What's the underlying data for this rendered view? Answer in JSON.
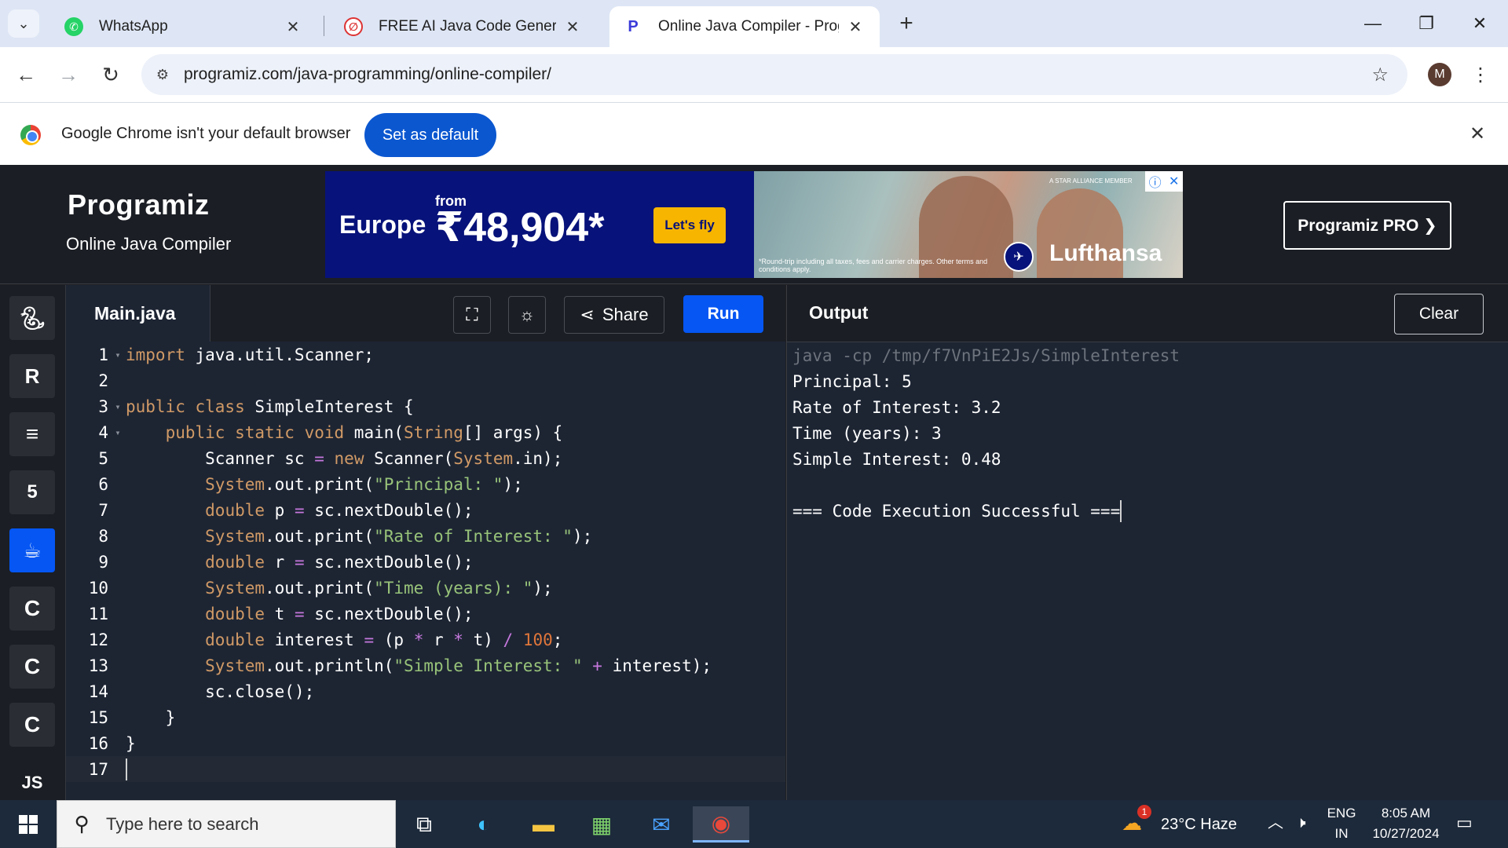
{
  "browser": {
    "tabs": [
      {
        "title": "WhatsApp",
        "icon": "whatsapp-icon"
      },
      {
        "title": "FREE AI Java Code Generator: G",
        "icon": "codegen-icon"
      },
      {
        "title": "Online Java Compiler - Program",
        "icon": "programiz-icon"
      }
    ],
    "url": "programiz.com/java-programming/online-compiler/",
    "profile_initial": "M"
  },
  "infobar": {
    "message": "Google Chrome isn't your default browser",
    "button": "Set as default"
  },
  "header": {
    "logo": "Programiz",
    "subtitle": "Online Java Compiler",
    "pro_button": "Programiz PRO ❯"
  },
  "ad": {
    "destination": "Europe",
    "from": "from",
    "price": "₹48,904*",
    "cta": "Let's fly",
    "brand": "Lufthansa",
    "terms": "*Round-trip including all taxes, fees and carrier charges. Other terms and conditions apply.",
    "alliance": "A STAR ALLIANCE MEMBER"
  },
  "languages": [
    "python",
    "r",
    "sql",
    "html",
    "java",
    "c",
    "cpp",
    "csharp",
    "JS"
  ],
  "editor": {
    "file_name": "Main.java",
    "share_label": "Share",
    "run_label": "Run",
    "line_numbers": [
      "1",
      "2",
      "3",
      "4",
      "5",
      "6",
      "7",
      "8",
      "9",
      "10",
      "11",
      "12",
      "13",
      "14",
      "15",
      "16",
      "17"
    ]
  },
  "output": {
    "title": "Output",
    "clear_label": "Clear",
    "lines": [
      "java -cp /tmp/f7VnPiE2Js/SimpleInterest",
      "Principal: 5",
      "Rate of Interest: 3.2",
      "Time (years): 3",
      "Simple Interest: 0.48",
      "",
      "=== Code Execution Successful ==="
    ]
  },
  "taskbar": {
    "search_placeholder": "Type here to search",
    "weather": "23°C  Haze",
    "weather_badge": "1",
    "lang_top": "ENG",
    "lang_bottom": "IN",
    "time": "8:05 AM",
    "date": "10/27/2024"
  },
  "colors": {
    "accent": "#0556f3",
    "editor_bg": "#1d2533",
    "keyword": "#d19a66",
    "string": "#98c379",
    "number": "#e0763a"
  }
}
